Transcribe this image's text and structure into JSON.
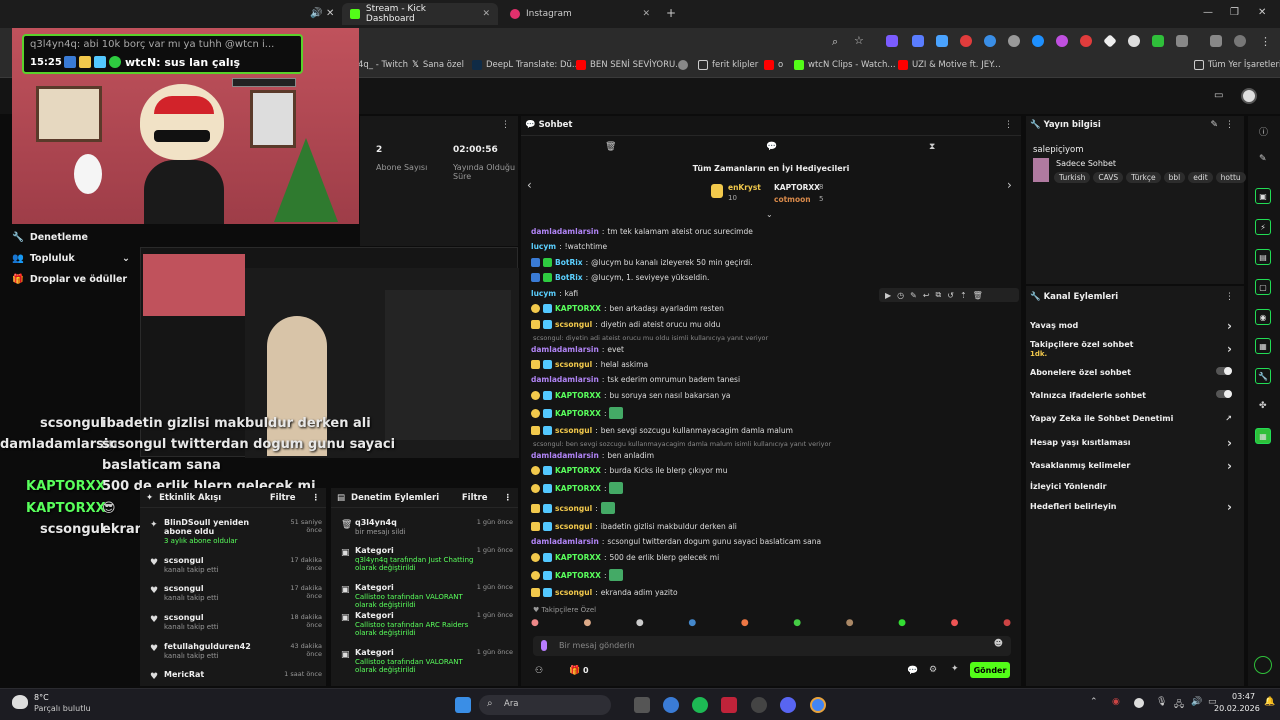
{
  "browser": {
    "tabs": [
      {
        "label": "Stream - Kick Dashboard",
        "active": true
      },
      {
        "label": "Instagram",
        "active": false
      }
    ],
    "bookmarks": [
      "4q_ - Twitch",
      "Sana özel",
      "DeepL Translate: Dü...",
      "BEN SENİ SEVİYORU...",
      "ferit klipler",
      "o",
      "wtcN Clips - Watch...",
      "UZI & Motive ft. JEY..."
    ],
    "bookmarks_all": "Tüm Yer İşaretleri"
  },
  "overlay_popup": {
    "title": "q3l4yn4q: abi 10k borç var mı ya tuhh @wtcn i...",
    "time": "15:25",
    "message": "wtcN: sus lan çalış"
  },
  "overlay_chat": [
    {
      "user": "scsongul",
      "text": "ibadetin gizlisi makbuldur derken ali",
      "color": "#e8e8e8"
    },
    {
      "user": "damladamlarsin",
      "text": "scsongul twitterdan dogum gunu sayaci",
      "color": "#e8e8e8"
    },
    {
      "user": "",
      "text": "baslaticam sana",
      "color": "#e8e8e8"
    },
    {
      "user": "KAPTORXX",
      "text": "500 de erlik blerp gelecek mi",
      "color": "#59ff5c"
    },
    {
      "user": "KAPTORXX",
      "text": "",
      "color": "#59ff5c"
    },
    {
      "user": "scsongul",
      "text": "ekranda adim yazito",
      "color": "#e8e8e8"
    }
  ],
  "sidebar": {
    "items": [
      "Denetleme",
      "Topluluk",
      "Droplar ve ödüller"
    ]
  },
  "stats": {
    "subs_value": "2",
    "subs_label": "Abone Sayısı",
    "uptime_value": "02:00:56",
    "uptime_label": "Yayında Olduğu Süre"
  },
  "activity": {
    "title": "Etkinlik Akışı",
    "filter": "Filtre",
    "items": [
      {
        "name": "BlinDSoull yeniden abone oldu",
        "sub": "3 aylık abone oldular",
        "time": "51 saniye önce"
      },
      {
        "name": "scsongul",
        "sub": "kanalı takip etti",
        "time": "17 dakika önce"
      },
      {
        "name": "scsongul",
        "sub": "kanalı takip etti",
        "time": "17 dakika önce"
      },
      {
        "name": "scsongul",
        "sub": "kanalı takip etti",
        "time": "18 dakika önce"
      },
      {
        "name": "fetullahgulduren42",
        "sub": "kanalı takip etti",
        "time": "43 dakika önce"
      },
      {
        "name": "MericRat",
        "sub": "",
        "time": "1 saat önce"
      }
    ]
  },
  "modlog": {
    "title": "Denetim Eylemleri",
    "filter": "Filtre",
    "items": [
      {
        "name": "q3l4yn4q",
        "sub": "bir mesajı sildi",
        "time": "1 gün önce"
      },
      {
        "name": "Kategori",
        "sub": "q3l4yn4q tarafından Just Chatting olarak değiştirildi",
        "time": "1 gün önce"
      },
      {
        "name": "Kategori",
        "sub": "Callistoo tarafından VALORANT olarak değiştirildi",
        "time": "1 gün önce"
      },
      {
        "name": "Kategori",
        "sub": "Callistoo tarafından ARC Raiders olarak değiştirildi",
        "time": "1 gün önce"
      },
      {
        "name": "Kategori",
        "sub": "Callistoo tarafından VALORANT olarak değiştirildi",
        "time": "1 gün önce"
      }
    ]
  },
  "chat": {
    "title": "Sohbet",
    "leaderboard_title": "Tüm Zamanların en İyi Hediyecileri",
    "top_gifters": [
      {
        "name": "enKryst",
        "count": "10"
      },
      {
        "name": "KAPTORXX",
        "count": "8"
      },
      {
        "name": "cotmoon",
        "count": "5"
      }
    ],
    "messages": [
      {
        "user": "damladamlarsin",
        "text": "tm tek kalamam ateist oruc surecimde",
        "color": "#b084f5",
        "badge": ""
      },
      {
        "user": "lucym",
        "text": "!watchtime",
        "color": "#5bd0ff",
        "badge": ""
      },
      {
        "user": "BotRix",
        "text": "@lucym bu kanalı izleyerek 50 min geçirdi.",
        "color": "#5bd0ff",
        "badge": "bot"
      },
      {
        "user": "BotRix",
        "text": "@lucym, 1. seviyeye yükseldin.",
        "color": "#5bd0ff",
        "badge": "bot"
      },
      {
        "user": "lucym",
        "text": "kafi",
        "color": "#5bd0ff",
        "badge": ""
      },
      {
        "user": "KAPTORXX",
        "text": "ben arkadaşı ayarladım resten",
        "color": "#59ff5c",
        "badge": "gift"
      },
      {
        "user": "scsongul",
        "text": "diyetin adi ateist orucu mu oldu",
        "color": "#f2c94c",
        "badge": "crown"
      },
      {
        "reply": "scsongul: diyetin adi ateist orucu mu oldu isimli kullanıcıya yanıt veriyor"
      },
      {
        "user": "damladamlarsin",
        "text": "evet",
        "color": "#b084f5",
        "badge": ""
      },
      {
        "user": "scsongul",
        "text": "helal askima",
        "color": "#f2c94c",
        "badge": "crown"
      },
      {
        "user": "damladamlarsin",
        "text": "tsk ederim omrumun badem tanesi",
        "color": "#b084f5",
        "badge": ""
      },
      {
        "user": "KAPTORXX",
        "text": "bu soruya sen nasıl bakarsan ya",
        "color": "#59ff5c",
        "badge": "gift"
      },
      {
        "user": "KAPTORXX",
        "text": "",
        "color": "#59ff5c",
        "badge": "gift"
      },
      {
        "user": "scsongul",
        "text": "ben sevgi sozcugu kullanmayacagim damla malum",
        "color": "#f2c94c",
        "badge": "crown"
      },
      {
        "reply": "scsongul: ben sevgi sozcugu kullanmayacagim damla malum isimli kullanıcıya yanıt veriyor"
      },
      {
        "user": "damladamlarsin",
        "text": "ben anladim",
        "color": "#b084f5",
        "badge": ""
      },
      {
        "user": "KAPTORXX",
        "text": "burda Kicks ile blerp çıkıyor mu",
        "color": "#59ff5c",
        "badge": "gift"
      },
      {
        "user": "KAPTORXX",
        "text": "",
        "color": "#59ff5c",
        "badge": "gift"
      },
      {
        "user": "scsongul",
        "text": "",
        "color": "#f2c94c",
        "badge": "crown"
      },
      {
        "user": "scsongul",
        "text": "ibadetin gizlisi makbuldur derken ali",
        "color": "#f2c94c",
        "badge": "crown"
      },
      {
        "user": "damladamlarsin",
        "text": "scsongul twitterdan dogum gunu sayaci baslaticam sana",
        "color": "#b084f5",
        "badge": ""
      },
      {
        "user": "KAPTORXX",
        "text": "500 de erlik blerp gelecek mi",
        "color": "#59ff5c",
        "badge": "gift"
      },
      {
        "user": "KAPTORXX",
        "text": "",
        "color": "#59ff5c",
        "badge": "gift"
      },
      {
        "user": "scsongul",
        "text": "ekranda adim yazito",
        "color": "#f2c94c",
        "badge": "crown"
      }
    ],
    "followers_only": "Takipçilere Özel",
    "input_placeholder": "Bir mesaj gönderin",
    "points": "0",
    "send_label": "Gönder"
  },
  "stream_info": {
    "title": "Yayın bilgisi",
    "stream_title": "salepiçiyom",
    "category": "Sadece Sohbet",
    "tags": [
      "Turkish",
      "CAVS",
      "Türkçe",
      "bbl",
      "edit",
      "hottu"
    ]
  },
  "channel_actions": {
    "title": "Kanal Eylemleri",
    "items": [
      {
        "label": "Yavaş mod",
        "control": "chevron",
        "sub": ""
      },
      {
        "label": "Takipçilere özel sohbet",
        "control": "chevron",
        "sub": "1dk."
      },
      {
        "label": "Abonelere özel sohbet",
        "control": "toggle",
        "sub": ""
      },
      {
        "label": "Yalnızca ifadelerle sohbet",
        "control": "toggle",
        "sub": ""
      },
      {
        "label": "Yapay Zeka ile Sohbet Denetimi",
        "control": "external",
        "sub": ""
      },
      {
        "label": "Hesap yaşı kısıtlaması",
        "control": "chevron",
        "sub": ""
      },
      {
        "label": "Yasaklanmış kelimeler",
        "control": "chevron",
        "sub": ""
      },
      {
        "label": "İzleyici Yönlendir",
        "control": "none",
        "sub": ""
      },
      {
        "label": "Hedefleri belirleyin",
        "control": "chevron",
        "sub": ""
      }
    ]
  },
  "taskbar": {
    "weather_temp": "8°C",
    "weather_desc": "Parçalı bulutlu",
    "search_placeholder": "Ara",
    "time": "03:47",
    "date": "20.02.2026"
  },
  "colors": {
    "kick_green": "#53fc18",
    "bg": "#0c0c0c"
  }
}
